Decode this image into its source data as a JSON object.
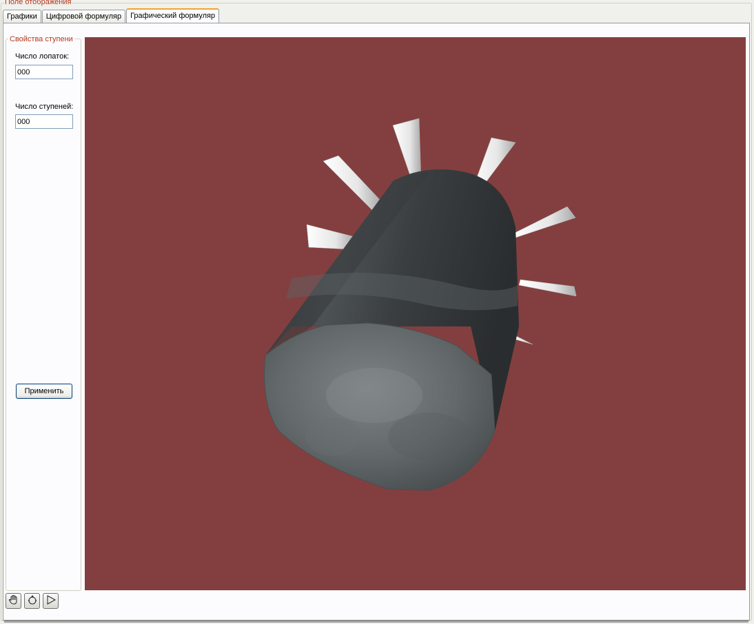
{
  "group": {
    "title": "Поле отображения"
  },
  "tabs": [
    {
      "label": "Графики",
      "active": false
    },
    {
      "label": "Цифровой формуляр",
      "active": false
    },
    {
      "label": "Графический формуляр",
      "active": true
    }
  ],
  "stage_properties": {
    "title": "Свойства ступени",
    "blade_count": {
      "label": "Число лопаток:",
      "value": "000"
    },
    "stage_count": {
      "label": "Число ступеней:",
      "value": "000"
    },
    "apply_label": "Применить"
  },
  "viewport": {
    "background": "#833f3f"
  },
  "toolbar": [
    {
      "icon": "hand-pan-icon"
    },
    {
      "icon": "rotate-icon"
    },
    {
      "icon": "play-icon"
    }
  ]
}
